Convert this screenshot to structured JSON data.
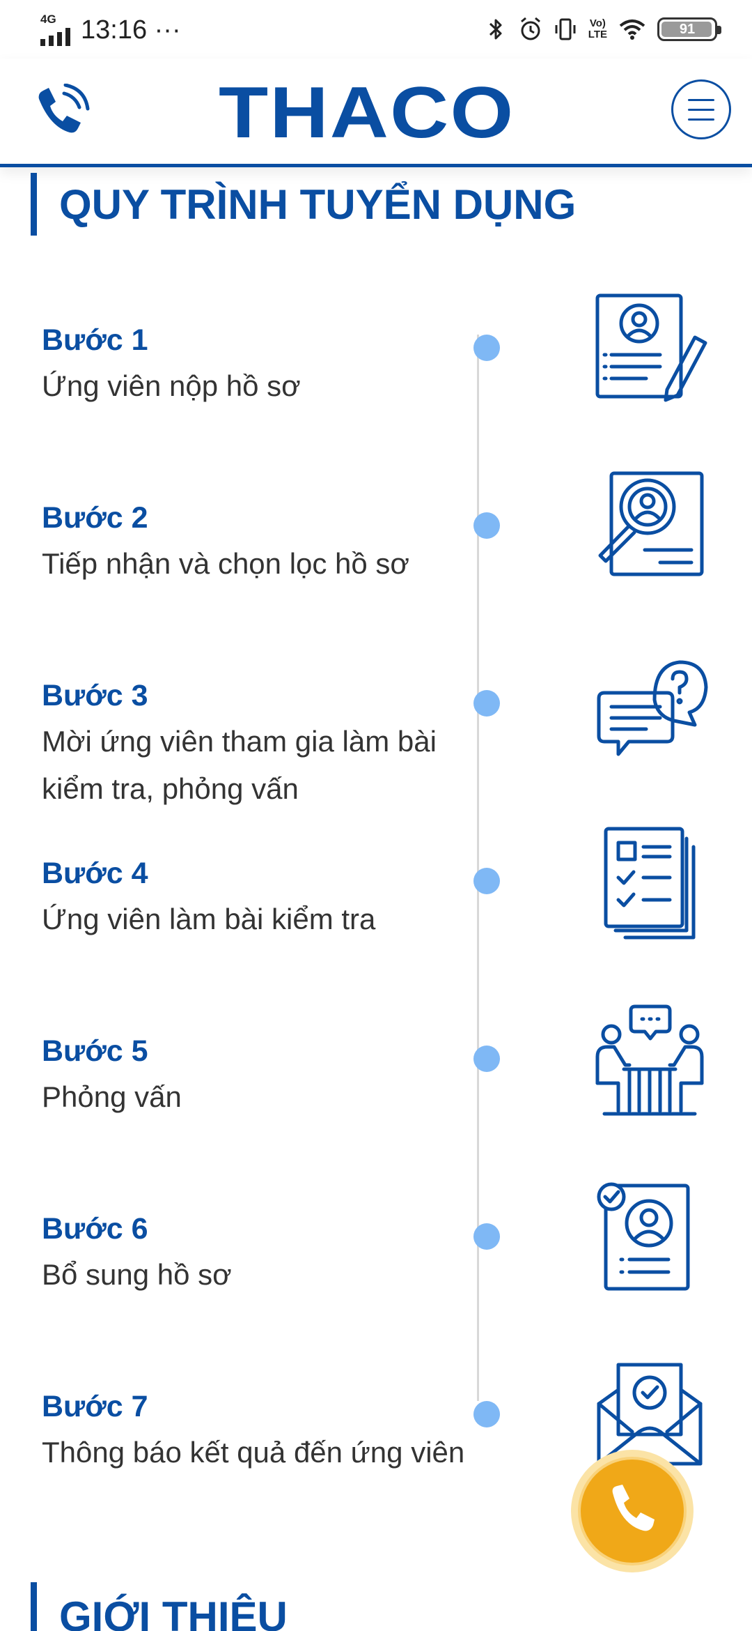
{
  "status_bar": {
    "network": "4G",
    "time": "13:16",
    "more": "···",
    "volte_top": "Vo)",
    "volte_bottom": "LTE",
    "battery": "91",
    "icons": [
      "signal-icon",
      "bluetooth-icon",
      "alarm-icon",
      "vibrate-icon",
      "volte-icon",
      "wifi-icon",
      "battery-icon"
    ]
  },
  "header": {
    "logo": "THACO",
    "phone_icon": "phone-icon",
    "menu_icon": "hamburger-menu-icon"
  },
  "section": {
    "title": "QUY TRÌNH TUYỂN DỤNG"
  },
  "steps": [
    {
      "label": "Bước 1",
      "description": "Ứng viên nộp hồ sơ",
      "icon": "resume-pen-icon"
    },
    {
      "label": "Bước 2",
      "description": "Tiếp nhận và chọn lọc hồ sơ",
      "icon": "profile-search-icon"
    },
    {
      "label": "Bước 3",
      "description": "Mời ứng viên tham gia làm bài kiểm tra, phỏng vấn",
      "icon": "chat-question-icon"
    },
    {
      "label": "Bước 4",
      "description": "Ứng viên làm bài kiểm tra",
      "icon": "checklist-icon"
    },
    {
      "label": "Bước 5",
      "description": "Phỏng vấn",
      "icon": "interview-icon"
    },
    {
      "label": "Bước 6",
      "description": "Bổ sung hồ sơ",
      "icon": "profile-check-icon"
    },
    {
      "label": "Bước 7",
      "description": "Thông báo kết quả đến ứng viên",
      "icon": "envelope-check-icon"
    }
  ],
  "next_section": {
    "title": "GIỚI THIỆU"
  },
  "colors": {
    "brand": "#0a4ea2",
    "timeline_dot": "#7fb8f5",
    "call_button": "#f0a818"
  }
}
